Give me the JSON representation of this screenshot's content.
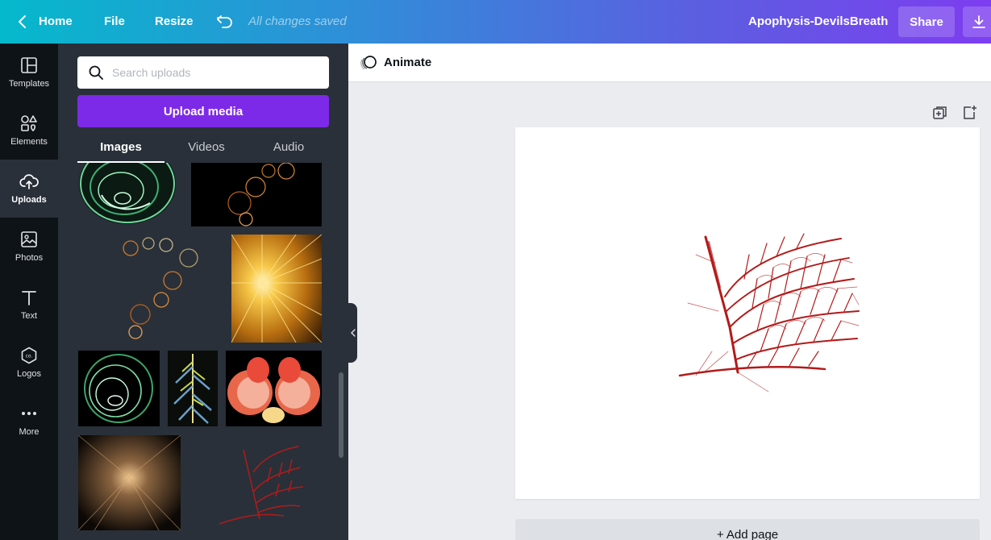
{
  "topbar": {
    "home_label": "Home",
    "file_label": "File",
    "resize_label": "Resize",
    "save_status": "All changes saved",
    "document_title": "Apophysis-DevilsBreath",
    "share_label": "Share",
    "back_icon": "chevron-left-icon",
    "undo_icon": "undo-icon",
    "download_icon": "download-icon"
  },
  "rail": {
    "items": [
      {
        "label": "Templates",
        "icon": "templates-icon",
        "active": false
      },
      {
        "label": "Elements",
        "icon": "elements-icon",
        "active": false
      },
      {
        "label": "Uploads",
        "icon": "cloud-upload-icon",
        "active": true
      },
      {
        "label": "Photos",
        "icon": "photo-icon",
        "active": false
      },
      {
        "label": "Text",
        "icon": "text-icon",
        "active": false
      },
      {
        "label": "Logos",
        "icon": "logo-badge-icon",
        "active": false
      },
      {
        "label": "More",
        "icon": "more-dots-icon",
        "active": false
      }
    ]
  },
  "panel": {
    "search_placeholder": "Search uploads",
    "upload_label": "Upload media",
    "tabs": [
      {
        "label": "Images",
        "active": true
      },
      {
        "label": "Videos",
        "active": false
      },
      {
        "label": "Audio",
        "active": false
      }
    ],
    "thumbnails": [
      {
        "name": "green-swirl-sphere",
        "color": "#2f8f5a"
      },
      {
        "name": "orange-bubble-chain-dark",
        "color": "#b5601c"
      },
      {
        "name": "orange-bubble-chain-light",
        "color": "#c87a2c"
      },
      {
        "name": "golden-starburst",
        "color": "#f2b23a"
      },
      {
        "name": "green-swirl-dark",
        "color": "#3fa36a"
      },
      {
        "name": "blue-yellow-feather",
        "color": "#6aa0c8"
      },
      {
        "name": "red-peach-flower",
        "color": "#e8674a"
      },
      {
        "name": "brown-nebula",
        "color": "#8a6440"
      },
      {
        "name": "red-fractal-tree",
        "color": "#b31a1a"
      }
    ]
  },
  "editor": {
    "animate_label": "Animate",
    "add_page_label": "+ Add page",
    "canvas_image": "red-fractal-tree",
    "accent_color": "#b31a1a"
  },
  "colors": {
    "brand_purple": "#7d2ae8",
    "rail_bg": "#0e1318",
    "panel_bg": "#293039"
  }
}
